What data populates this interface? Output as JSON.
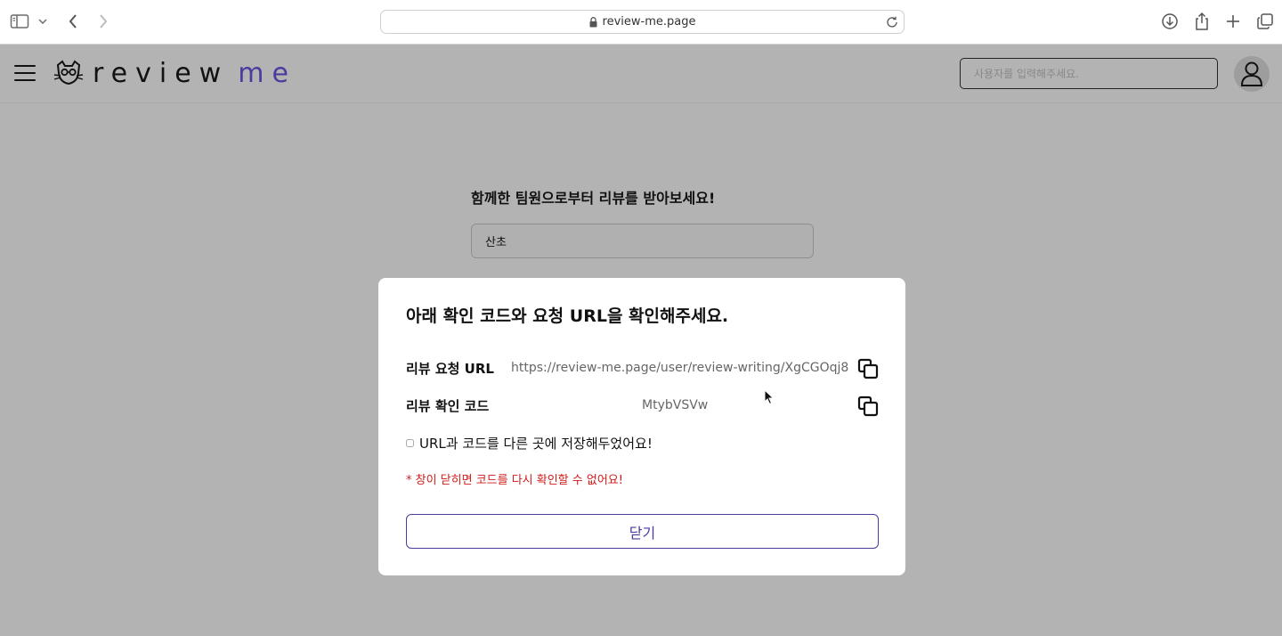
{
  "browser": {
    "url": "review-me.page",
    "icons": [
      "sidebar-icon",
      "chevron-down-icon",
      "back-icon",
      "forward-icon",
      "lock-icon",
      "reload-icon",
      "download-icon",
      "share-icon",
      "plus-icon",
      "tabs-icon"
    ]
  },
  "header": {
    "logo_text": "review",
    "logo_accent": "me",
    "search_placeholder": "사용자를 입력해주세요.",
    "colors": {
      "accent": "#4b3aa0"
    }
  },
  "page": {
    "heading": "함께한 팀원으로부터 리뷰를 받아보세요!",
    "name_value": "산초"
  },
  "modal": {
    "title": "아래 확인 코드와 요청 URL을 확인해주세요.",
    "url_label": "리뷰 요청 URL",
    "url_value": "https://review-me.page/user/review-writing/XgCGOqj8",
    "code_label": "리뷰 확인 코드",
    "code_value": "MtybVSVw",
    "confirm_label": "URL과 코드를 다른 곳에 저장해두었어요!",
    "warning": "* 창이 닫히면 코드를 다시 확인할 수 없어요!",
    "close_label": "닫기",
    "colors": {
      "warning": "#d11a1a",
      "button": "#4b3aa0"
    }
  }
}
